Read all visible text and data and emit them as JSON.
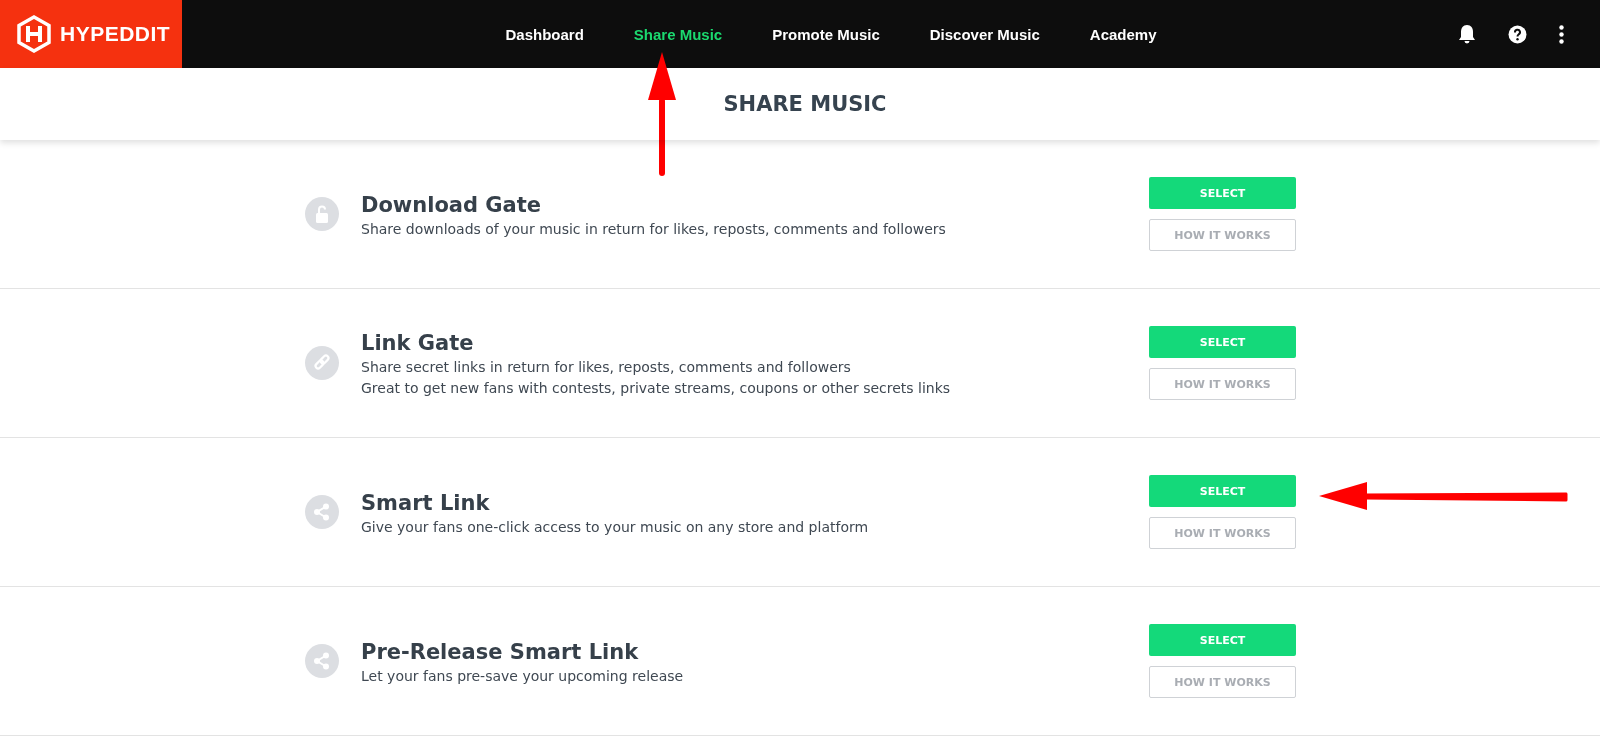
{
  "brand": {
    "name": "HYPEDDIT"
  },
  "nav": [
    {
      "label": "Dashboard",
      "selected": false
    },
    {
      "label": "Share Music",
      "selected": true
    },
    {
      "label": "Promote Music",
      "selected": false
    },
    {
      "label": "Discover Music",
      "selected": false
    },
    {
      "label": "Academy",
      "selected": false
    }
  ],
  "page_title": "SHARE MUSIC",
  "options": [
    {
      "kind": "lock",
      "title": "Download Gate",
      "description": [
        "Share downloads of your music in return for likes, reposts, comments and followers"
      ],
      "select": "SELECT",
      "how": "HOW IT WORKS"
    },
    {
      "kind": "link",
      "title": "Link Gate",
      "description": [
        "Share secret links in return for likes, reposts, comments and followers",
        "Great to get new fans with contests, private streams, coupons or other secrets links"
      ],
      "select": "SELECT",
      "how": "HOW IT WORKS"
    },
    {
      "kind": "share",
      "title": "Smart Link",
      "description": [
        "Give your fans one-click access to your music on any store and platform"
      ],
      "select": "SELECT",
      "how": "HOW IT WORKS"
    },
    {
      "kind": "share",
      "title": "Pre-Release Smart Link",
      "description": [
        "Let your fans pre-save your upcoming release"
      ],
      "select": "SELECT",
      "how": "HOW IT WORKS"
    }
  ]
}
